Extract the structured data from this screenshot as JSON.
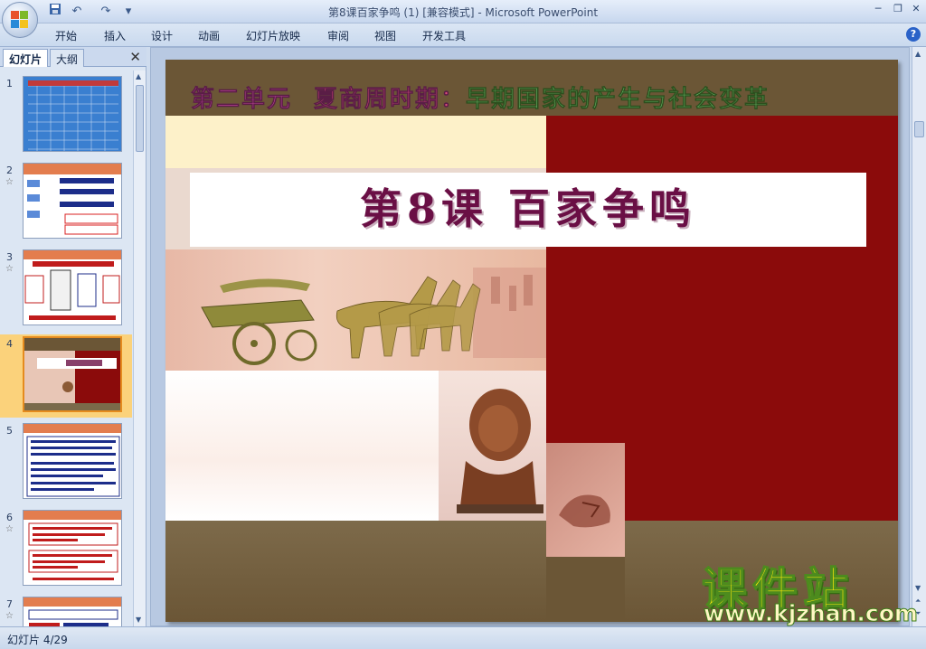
{
  "window": {
    "title": "第8课百家争鸣 (1) [兼容模式] - Microsoft PowerPoint",
    "minimize_glyph": "─",
    "restore_glyph": "❐",
    "close_glyph": "✕"
  },
  "quick_access": {
    "save_icon": "save-icon",
    "undo_glyph": "↶",
    "redo_glyph": "↷",
    "customize_glyph": "▾"
  },
  "ribbon": {
    "tabs": [
      "开始",
      "插入",
      "设计",
      "动画",
      "幻灯片放映",
      "审阅",
      "视图",
      "开发工具"
    ],
    "help_label": "?"
  },
  "left_panel": {
    "tab_slides": "幻灯片",
    "tab_outline": "大纲",
    "close_glyph": "✕",
    "thumbnails": [
      {
        "number": "1",
        "selected": false
      },
      {
        "number": "2",
        "selected": false
      },
      {
        "number": "3",
        "selected": false
      },
      {
        "number": "4",
        "selected": true
      },
      {
        "number": "5",
        "selected": false
      },
      {
        "number": "6",
        "selected": false
      },
      {
        "number": "7",
        "selected": false
      }
    ],
    "star_glyph": "☆"
  },
  "slide": {
    "unit_title_part1": "第二单元",
    "unit_title_part2": "夏商周时期：",
    "unit_title_part3": "早期国家的产生与社会变革",
    "lesson_title": "第8课  百家争鸣"
  },
  "watermark": {
    "brand": "课件站",
    "url": "www.kjzhan.com"
  },
  "status": {
    "slide_counter": "幻灯片 4/29"
  },
  "colors": {
    "slide_top_band": "#6b5636",
    "slide_red": "#8b0b0b",
    "lesson_title": "#6a0f45",
    "selection": "#fbd27b"
  }
}
